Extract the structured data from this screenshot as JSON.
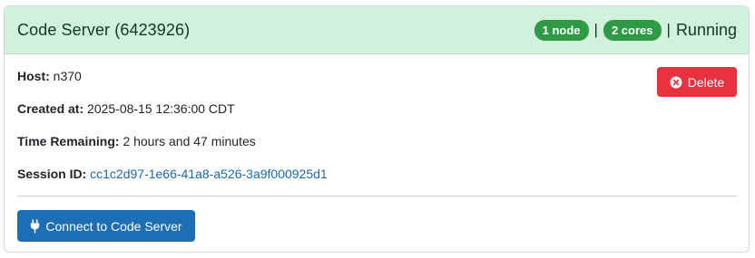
{
  "card": {
    "title": "Code Server (6423926)",
    "nodes_badge": "1 node",
    "cores_badge": "2 cores",
    "separator": "|",
    "status": "Running"
  },
  "details": {
    "host_label": "Host:",
    "host_value": "n370",
    "created_label": "Created at:",
    "created_value": "2025-08-15 12:36:00 CDT",
    "time_label": "Time Remaining:",
    "time_value": "2 hours and 47 minutes",
    "session_label": "Session ID:",
    "session_value": "cc1c2d97-1e66-41a8-a526-3a9f000925d1"
  },
  "actions": {
    "delete_label": "Delete",
    "connect_label": "Connect to Code Server"
  },
  "icons": {
    "delete": "circle-x-icon",
    "connect": "plug-icon"
  },
  "colors": {
    "header_bg": "#d2f1dc",
    "badge_bg": "#2f9a46",
    "delete_bg": "#e8323f",
    "connect_bg": "#1c6fb4",
    "link": "#1a68b0"
  }
}
